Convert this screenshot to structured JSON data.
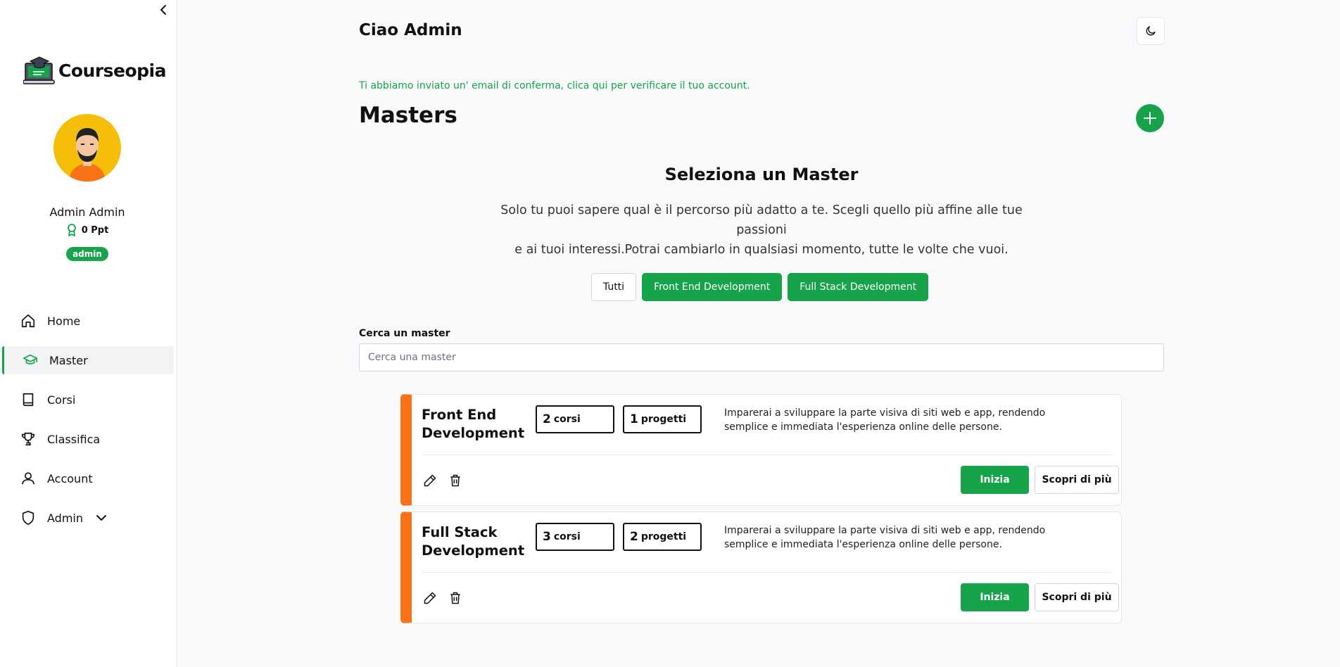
{
  "app": {
    "name": "Courseopia"
  },
  "user": {
    "name": "Admin Admin",
    "points": "0 Ppt",
    "role": "admin"
  },
  "nav": [
    {
      "label": "Home",
      "icon": "home-icon",
      "active": false
    },
    {
      "label": "Master",
      "icon": "graduation-cap-icon",
      "active": true
    },
    {
      "label": "Corsi",
      "icon": "book-icon",
      "active": false
    },
    {
      "label": "Classifica",
      "icon": "trophy-icon",
      "active": false
    },
    {
      "label": "Account",
      "icon": "user-icon",
      "active": false
    },
    {
      "label": "Admin",
      "icon": "shield-icon",
      "active": false
    }
  ],
  "header": {
    "greeting": "Ciao Admin"
  },
  "notice": "Ti abbiamo inviato un' email di conferma, clica qui per verificare il tuo account.",
  "page": {
    "title": "Masters"
  },
  "section": {
    "title": "Seleziona un Master",
    "desc_line1": "Solo tu puoi sapere qual è il percorso più adatto a te. Scegli quello più affine alle tue passioni",
    "desc_line2": "e ai tuoi interessi.Potrai cambiarlo in qualsiasi momento, tutte le volte che vuoi."
  },
  "filters": [
    "Tutti",
    "Front End Development",
    "Full Stack Development"
  ],
  "search": {
    "label": "Cerca un master",
    "placeholder": "Cerca una master",
    "value": ""
  },
  "masters": [
    {
      "title": "Front End Development",
      "courses_count": "2",
      "courses_label": "corsi",
      "projects_count": "1",
      "projects_label": "progetti",
      "description": "Imparerai a sviluppare la parte visiva di siti web e app, rendendo semplice e immediata l'esperienza online delle persone.",
      "start_label": "Inizia",
      "more_label": "Scopri di più"
    },
    {
      "title": "Full Stack Development",
      "courses_count": "3",
      "courses_label": "corsi",
      "projects_count": "2",
      "projects_label": "progetti",
      "description": "Imparerai a sviluppare la parte visiva di siti web e app, rendendo semplice e immediata l'esperienza online delle persone.",
      "start_label": "Inizia",
      "more_label": "Scopri di più"
    }
  ],
  "colors": {
    "accent": "#16a34a",
    "card_stripe": "#f97316",
    "avatar_bg": "#f5be0b"
  }
}
